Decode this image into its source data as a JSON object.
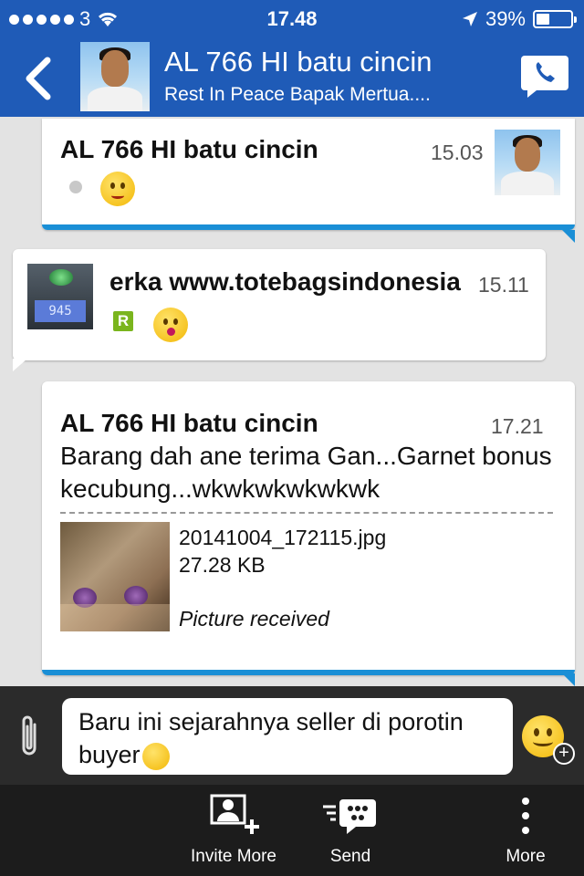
{
  "status_bar": {
    "carrier": "3",
    "time": "17.48",
    "battery": "39%",
    "battery_level": 0.39
  },
  "header": {
    "title": "AL 766 HI batu cincin",
    "subtitle": "Rest In Peace Bapak Mertua...."
  },
  "messages": [
    {
      "sender": "AL 766 HI batu cincin",
      "time": "15.03"
    },
    {
      "sender": "erka www.totebagsindonesia",
      "time": "15.11",
      "badge": "R",
      "scale_reading": "945"
    },
    {
      "sender": "AL 766 HI batu cincin",
      "time": "17.21",
      "text": "Barang dah ane terima Gan...Garnet bonus kecubung...wkwkwkwkwkwk",
      "attachment": {
        "file_name": "20141004_172115.jpg",
        "file_size": "27.28 KB",
        "status": "Picture received"
      }
    }
  ],
  "compose": {
    "text": "Baru ini sejarahnya seller di porotin buyer"
  },
  "toolbar": {
    "invite_label": "Invite More",
    "send_label": "Send",
    "more_label": "More"
  },
  "colors": {
    "header_bg": "#1f5bb7",
    "accent_line": "#1a8fd6",
    "toolbar_bg": "#1c1c1c"
  }
}
